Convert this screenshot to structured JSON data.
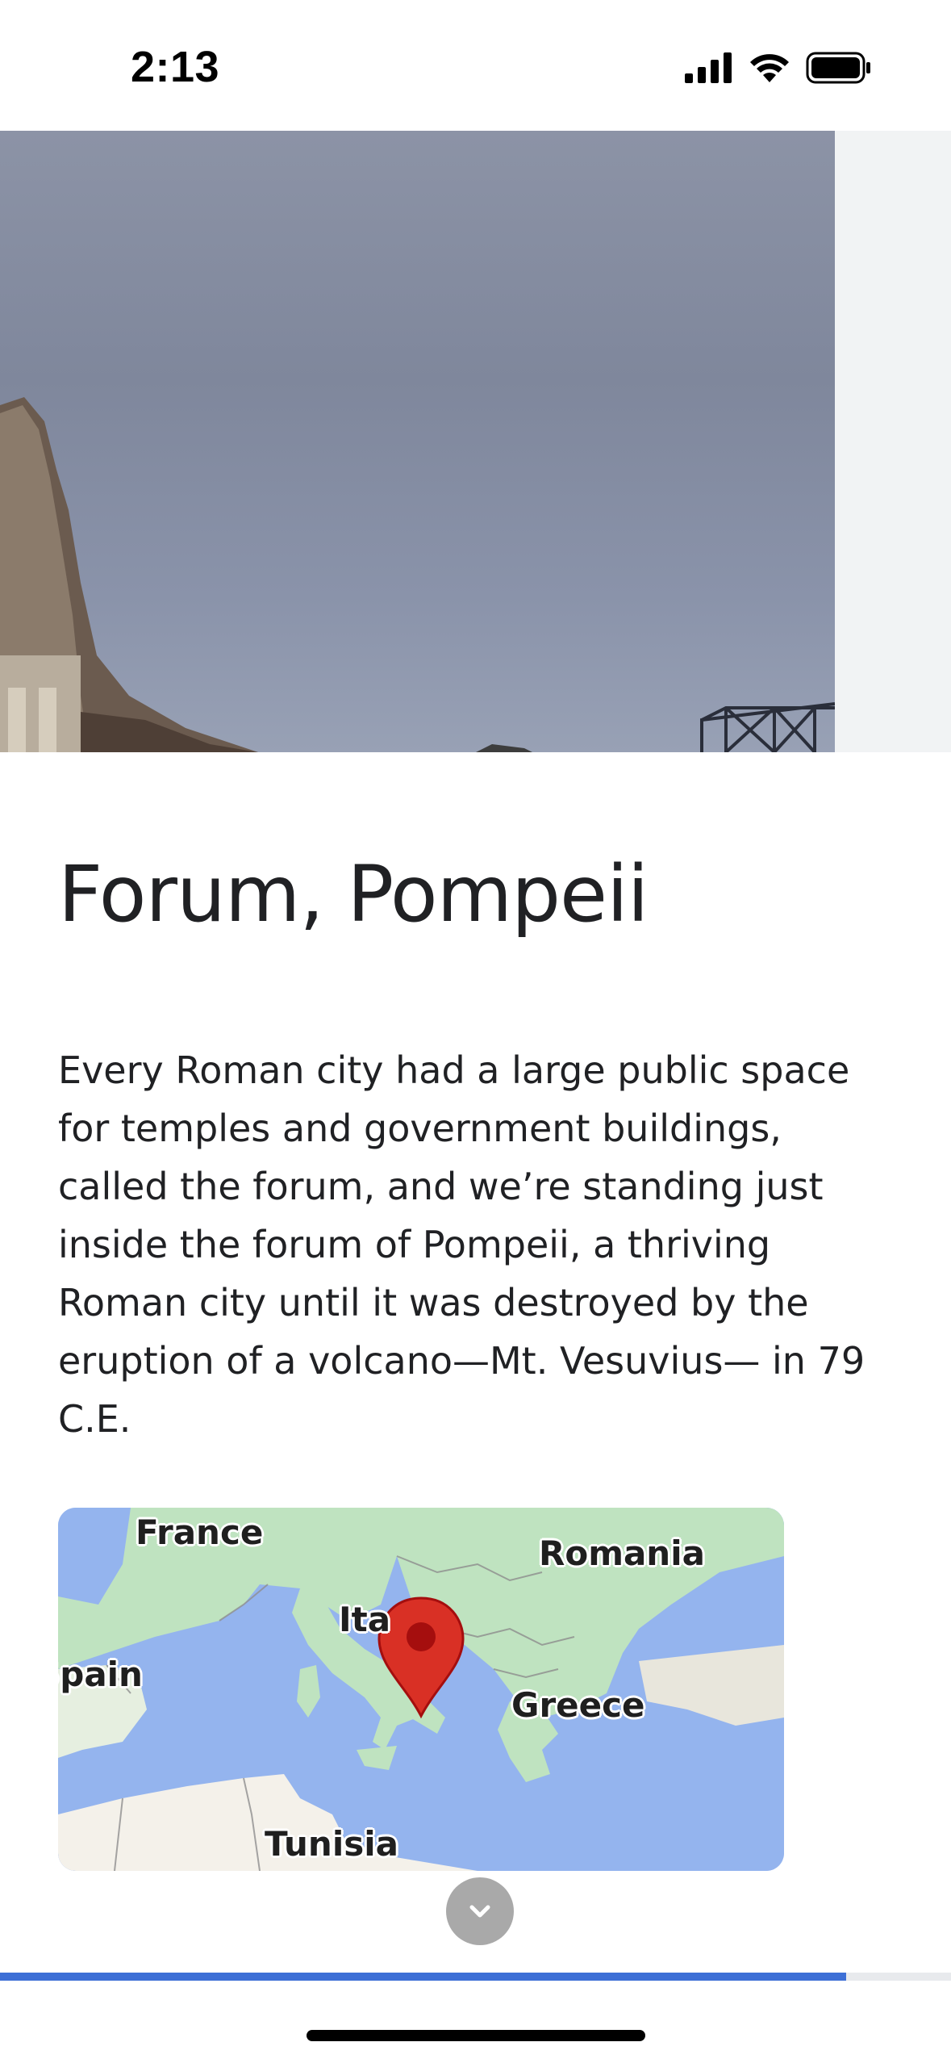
{
  "status_bar": {
    "time": "2:13"
  },
  "article": {
    "title": "Forum, Pompeii",
    "body": "Every Roman city had a large public space for temples and government buildings, called the forum, and we’re standing just inside the forum of Pompeii, a thriving Roman city until it was destroyed by the eruption of a volcano—Mt. Vesuvius— in 79 C.E."
  },
  "map": {
    "labels": {
      "france": "France",
      "romania": "Romania",
      "italy": "Ita",
      "spain": "Spain",
      "greece": "Greece",
      "tunisia": "Tunisia"
    },
    "marker_color": "#d93025",
    "water_color": "#94b4ee",
    "land_color": "#bfe3c0"
  },
  "progress": {
    "fraction": 0.89,
    "color": "#3d6fd6"
  },
  "icons": {
    "scroll": "chevron-down-icon",
    "signal": "cellular-signal-icon",
    "wifi": "wifi-icon",
    "battery": "battery-icon"
  }
}
